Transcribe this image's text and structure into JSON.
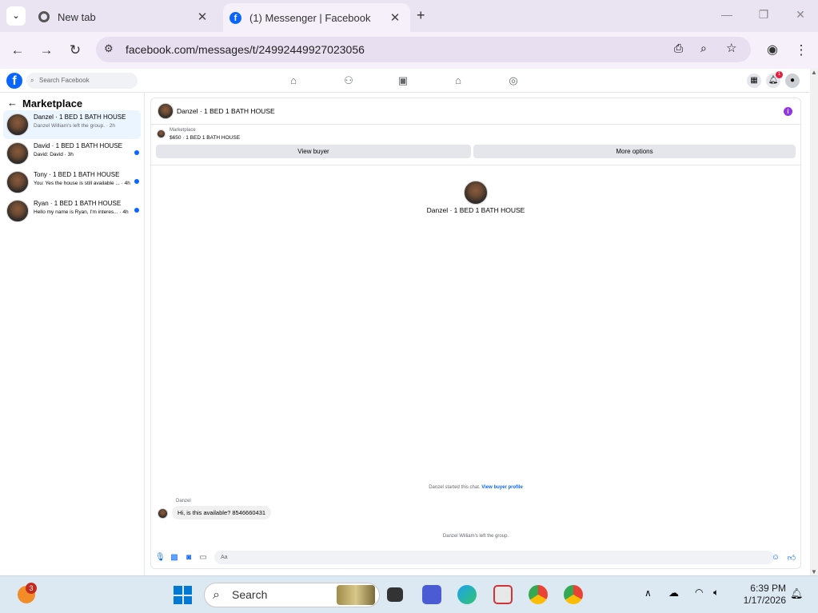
{
  "browser": {
    "tabs": [
      {
        "title": "New tab"
      },
      {
        "title": "(1) Messenger | Facebook"
      }
    ],
    "url": "facebook.com/messages/t/24992449927023056"
  },
  "fb": {
    "search_placeholder": "Search Facebook",
    "notif_count": "1"
  },
  "sidebar": {
    "title": "Marketplace",
    "conversations": [
      {
        "name": "Danzel · 1 BED 1 BATH HOUSE",
        "preview": "Danzel William's left the group. · 2h",
        "selected": true,
        "unread": false
      },
      {
        "name": "David · 1 BED 1 BATH HOUSE",
        "preview": "David: David · 3h",
        "selected": false,
        "unread": true
      },
      {
        "name": "Tony · 1 BED 1 BATH HOUSE",
        "preview": "You: Yes the house is still available ... · 4h",
        "selected": false,
        "unread": true
      },
      {
        "name": "Ryan · 1 BED 1 BATH HOUSE",
        "preview": "Hello my name is Ryan, I'm interes... · 4h",
        "selected": false,
        "unread": true
      }
    ]
  },
  "chat": {
    "title": "Danzel · 1 BED 1 BATH HOUSE",
    "marketplace_label": "Marketplace",
    "listing": "$650 · 1 BED 1 BATH HOUSE",
    "view_buyer": "View buyer",
    "more_options": "More options",
    "center_name": "Danzel · 1 BED 1 BATH HOUSE",
    "started_text": "Danzel started this chat.",
    "view_profile": "View buyer profile",
    "sender": "Danzel",
    "message": "Hi, is this available? 8546660431",
    "left_text": "Danzel William's left the group.",
    "input_placeholder": "Aa"
  },
  "taskbar": {
    "weather_badge": "3",
    "search_label": "Search",
    "time": "6:39 PM",
    "date": "1/17/2026"
  }
}
